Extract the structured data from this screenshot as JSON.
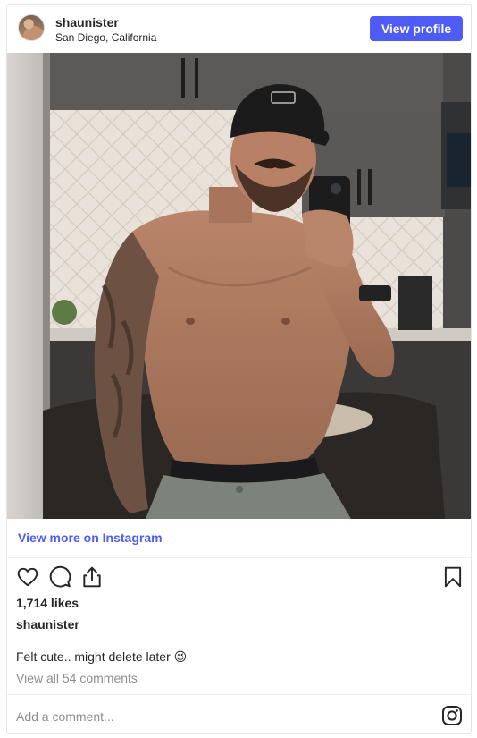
{
  "header": {
    "username": "shaunister",
    "location": "San Diego, California",
    "view_profile_label": "View profile"
  },
  "post": {
    "view_more_label": "View more on Instagram",
    "likes": "1,714 likes",
    "owner": "shaunister",
    "caption": "Felt cute.. might delete later 😉",
    "view_comments": "View all 54 comments"
  },
  "comment": {
    "placeholder": "Add a comment..."
  },
  "icons": {
    "like": "heart-icon",
    "comment": "comment-icon",
    "share": "share-icon",
    "save": "bookmark-icon",
    "instagram": "instagram-icon"
  },
  "colors": {
    "accent": "#4e5cf5",
    "text": "#262626",
    "muted": "#8e8e8e"
  }
}
